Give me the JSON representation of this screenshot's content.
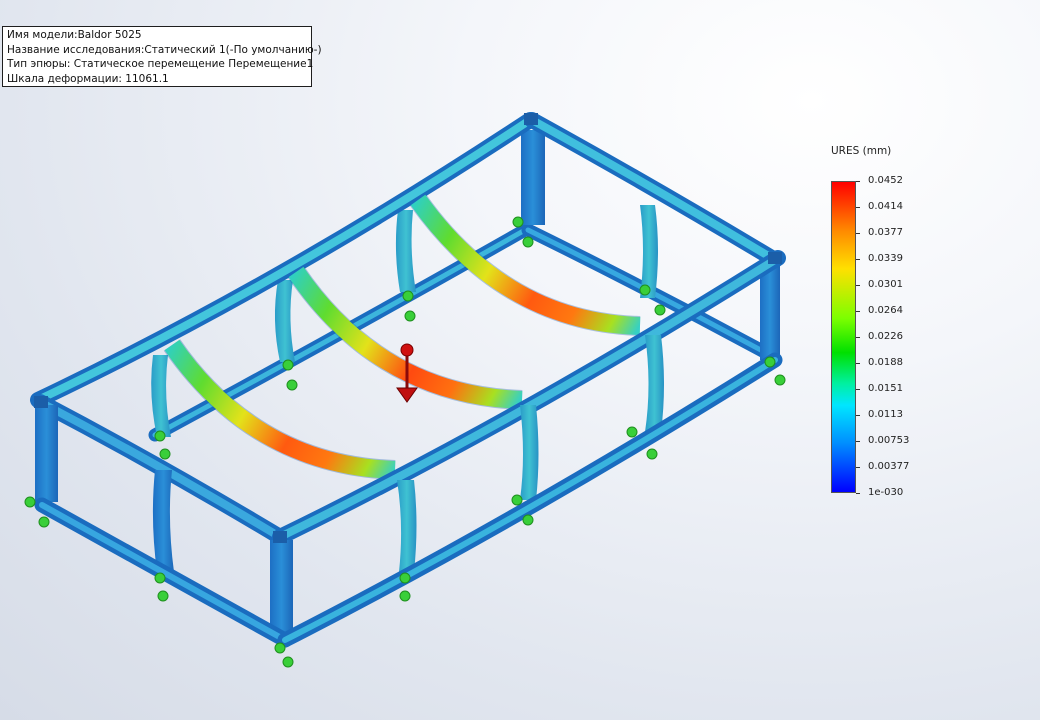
{
  "info": {
    "model_name": "Имя модели:Baldor 5025",
    "study_name": "Название исследования:Статический 1(-По умолчанию-)",
    "plot_type": "Тип эпюры: Статическое перемещение Перемещение1",
    "deformation_scale": "Шкала деформации: 11061.1"
  },
  "legend": {
    "title": "URES (mm)",
    "labels": [
      "0.0452",
      "0.0414",
      "0.0377",
      "0.0339",
      "0.0301",
      "0.0264",
      "0.0226",
      "0.0188",
      "0.0151",
      "0.0113",
      "0.00753",
      "0.00377",
      "1e-030"
    ],
    "colors": [
      "#ff0000",
      "#ff8c00",
      "#ffe000",
      "#7cff00",
      "#00e000",
      "#00f0a0",
      "#00e6ff",
      "#0090ff",
      "#0000ff"
    ]
  },
  "model": {
    "frame_color": "#1f83d4",
    "frame_highlight": "#41c6de",
    "fixture_color": "#3ad13a",
    "load_color": "#d01010"
  }
}
